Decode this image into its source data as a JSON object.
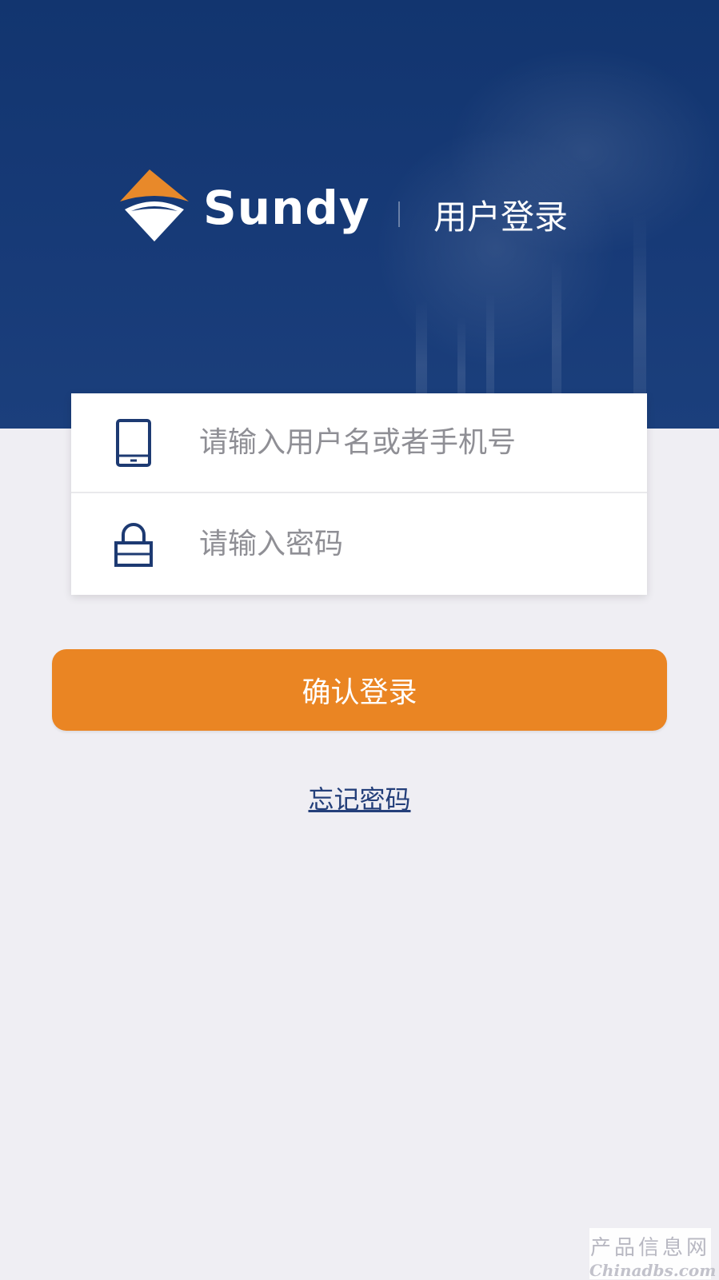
{
  "header": {
    "brand_name": "Sundy",
    "subtitle": "用户登录"
  },
  "form": {
    "username": {
      "placeholder": "请输入用户名或者手机号",
      "value": "",
      "icon": "tablet-icon"
    },
    "password": {
      "placeholder": "请输入密码",
      "value": "",
      "icon": "lock-icon"
    }
  },
  "actions": {
    "login_label": "确认登录",
    "forgot_label": "忘记密码"
  },
  "watermark": {
    "cn": "产品信息网",
    "en": "Chinadbs.com"
  },
  "colors": {
    "header_bg": "#173a77",
    "accent_orange": "#ea8523",
    "page_bg": "#efeef3",
    "icon_blue": "#1d3a72"
  }
}
